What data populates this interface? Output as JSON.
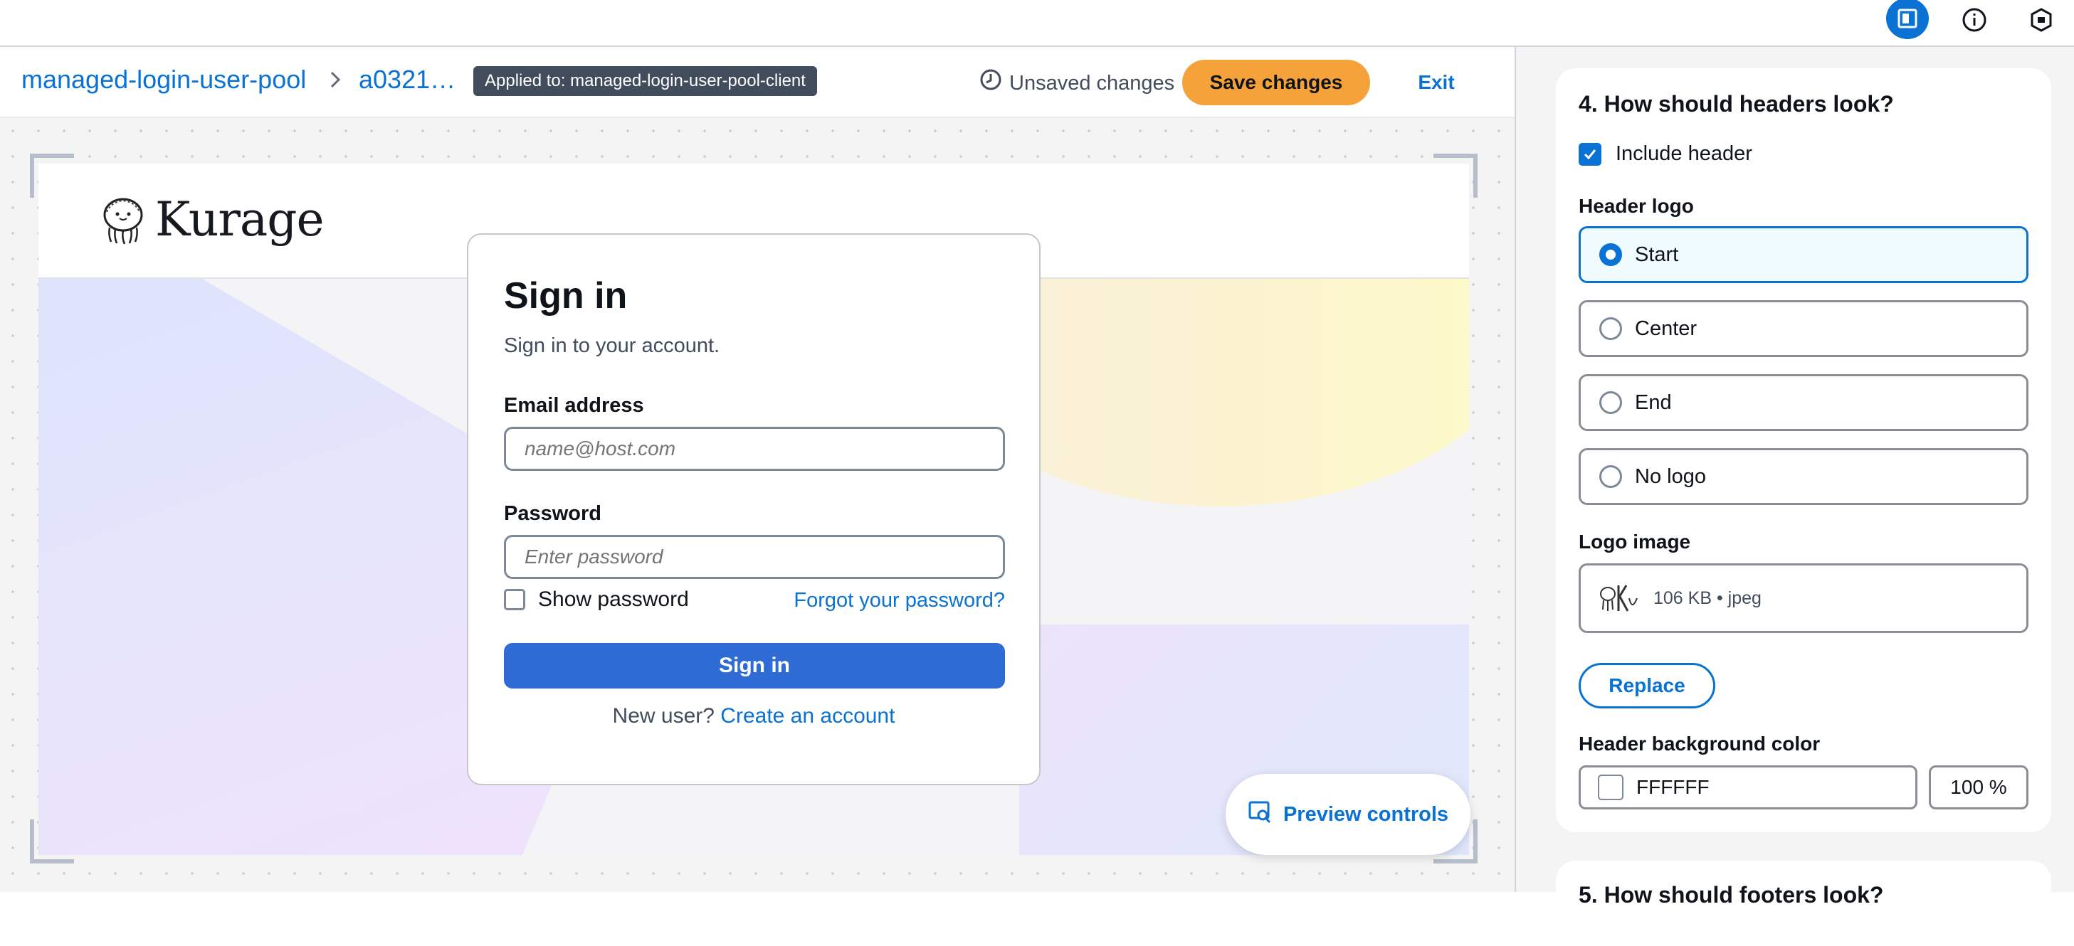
{
  "breadcrumb": {
    "pool": "managed-login-user-pool",
    "client": "a0321…"
  },
  "applied_badge": "Applied to: managed-login-user-pool-client",
  "unsaved_text": "Unsaved changes",
  "save_label": "Save changes",
  "exit_label": "Exit",
  "preview": {
    "brand_name": "Kurage",
    "signin": {
      "title": "Sign in",
      "subtitle": "Sign in to your account.",
      "email_label": "Email address",
      "email_placeholder": "name@host.com",
      "password_label": "Password",
      "password_placeholder": "Enter password",
      "show_password": "Show password",
      "forgot": "Forgot your password?",
      "button": "Sign in",
      "new_user": "New user?",
      "create_account": "Create an account"
    },
    "controls_label": "Preview controls"
  },
  "panel": {
    "section_title": "4. How should headers look?",
    "include_header": "Include header",
    "include_header_checked": true,
    "header_logo_label": "Header logo",
    "logo_options": [
      {
        "label": "Start",
        "selected": true
      },
      {
        "label": "Center",
        "selected": false
      },
      {
        "label": "End",
        "selected": false
      },
      {
        "label": "No logo",
        "selected": false
      }
    ],
    "logo_image_label": "Logo image",
    "logo_file_meta": "106 KB • jpeg",
    "replace_label": "Replace",
    "bg_color_label": "Header background color",
    "bg_color_value": "FFFFFF",
    "bg_opacity": "100 %",
    "next_section_title": "5. How should footers look?"
  },
  "colors": {
    "accent": "#0972d3",
    "save_button": "#f5a23b",
    "signin_button": "#2e6bd4"
  }
}
